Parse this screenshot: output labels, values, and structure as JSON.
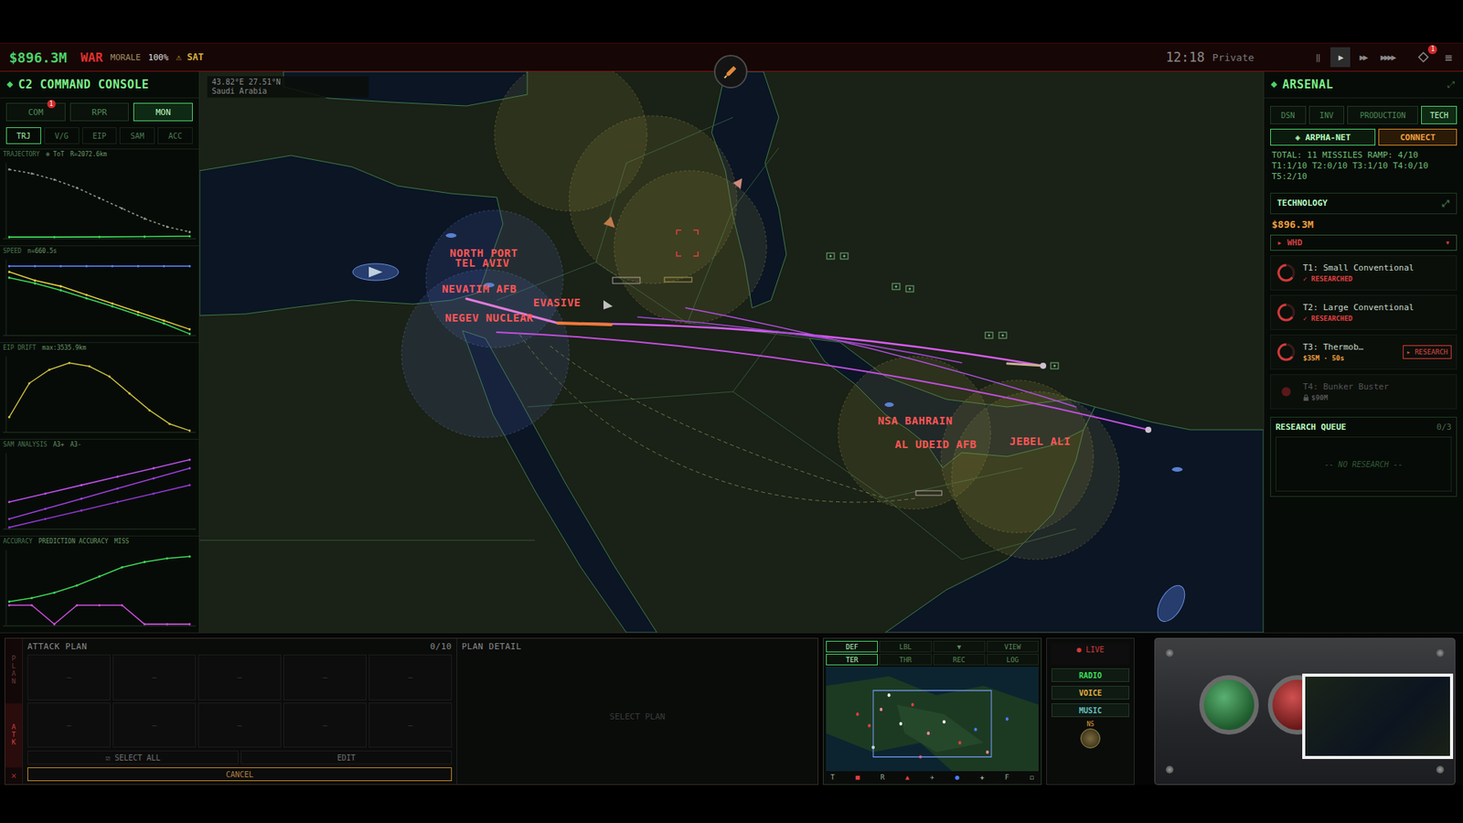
{
  "topbar": {
    "money": "$896.3M",
    "status": "WAR",
    "morale_label": "MORALE",
    "morale": "100%",
    "alert": "⚠ SAT",
    "clock": "12:18",
    "mode": "Private",
    "controls": [
      {
        "label": "‖",
        "selected": false
      },
      {
        "label": "▶",
        "selected": true
      },
      {
        "label": "▶▶",
        "selected": false
      },
      {
        "label": "▶▶▶▶",
        "selected": false
      }
    ],
    "notice_badge": "1",
    "menu": "≡"
  },
  "console": {
    "title": "C2 COMMAND CONSOLE",
    "tabs": [
      {
        "label": "COM",
        "selected": false,
        "badge": "1"
      },
      {
        "label": "RPR",
        "selected": false
      },
      {
        "label": "MON",
        "selected": true
      }
    ],
    "subtabs": [
      {
        "label": "TRJ",
        "selected": true
      },
      {
        "label": "V/G",
        "selected": false
      },
      {
        "label": "EIP",
        "selected": false
      },
      {
        "label": "SAM",
        "selected": false
      },
      {
        "label": "ACC",
        "selected": false
      }
    ],
    "charts": [
      {
        "title": "TRAJECTORY",
        "notes": [
          "⊗ ToT",
          "R=2072.6km"
        ],
        "series": [
          {
            "color": "#8a9a8a",
            "values": [
              400,
              380,
              350,
              310,
              260,
              210,
              160,
              120,
              95
            ]
          },
          {
            "color": "#3ddc5a",
            "values": [
              70,
              70,
              71,
              72,
              74
            ]
          }
        ]
      },
      {
        "title": "SPEED",
        "notes": [
          "n=660.5s"
        ],
        "series": [
          {
            "color": "#5a8aff",
            "values": [
              3.3,
              3.3,
              3.3,
              3.3,
              3.3,
              3.3,
              3.3,
              3.3
            ]
          },
          {
            "color": "#e0d040",
            "values": [
              3.2,
              3.05,
              2.95,
              2.8,
              2.65,
              2.5,
              2.35,
              2.2
            ]
          },
          {
            "color": "#3ddc5a",
            "values": [
              3.1,
              3.0,
              2.88,
              2.74,
              2.6,
              2.45,
              2.3,
              2.12
            ]
          }
        ]
      },
      {
        "title": "EIP DRIFT",
        "notes": [
          "max:3535.9km"
        ],
        "series": [
          {
            "color": "#c8c040",
            "values": [
              2.2,
              2.7,
              2.9,
              3.0,
              2.95,
              2.8,
              2.55,
              2.3,
              2.1,
              2.0
            ]
          }
        ]
      },
      {
        "title": "SAM ANALYSIS",
        "notes": [
          "A3+",
          "A3-"
        ],
        "series": [
          {
            "color": "#c050f0",
            "values": [
              2,
              3,
              4,
              5,
              6,
              7
            ]
          },
          {
            "color": "#a040e0",
            "values": [
              0,
              1.2,
              2.4,
              3.6,
              4.8,
              6
            ]
          },
          {
            "color": "#9038d0",
            "values": [
              -1,
              0,
              1,
              2,
              3,
              4
            ]
          }
        ]
      },
      {
        "title": "ACCURACY",
        "notes": [
          "PREDICTION ACCURACY",
          "MISS"
        ],
        "series": [
          {
            "color": "#3ddc5a",
            "values": [
              1,
              1.4,
              2,
              2.8,
              3.8,
              4.8,
              5.4,
              5.8,
              6
            ]
          },
          {
            "color": "#d050e0",
            "values": [
              0.6,
              0.6,
              -1.5,
              0.6,
              0.6,
              0.6,
              -1.5,
              -1.5,
              -1.5
            ]
          }
        ]
      }
    ]
  },
  "map": {
    "coords": "43.82°E 27.51°N",
    "region": "Saudi Arabia",
    "labels": [
      "NORTH PORT",
      "TEL AVIV",
      "NEVATIM AFB",
      "NEGEV NUCLEAR",
      "EVASIVE",
      "NSA BAHRAIN",
      "AL UDEID AFB",
      "JEBEL ALI"
    ]
  },
  "arsenal": {
    "title": "ARSENAL",
    "expand": "⤢",
    "tabs": [
      {
        "label": "DSN",
        "selected": false
      },
      {
        "label": "INV",
        "selected": false
      },
      {
        "label": "PRODUCTION",
        "selected": false
      },
      {
        "label": "TECH",
        "selected": true
      }
    ],
    "network": "◈ ARPHA-NET",
    "connect": "CONNECT",
    "stats": [
      "TOTAL: 11 MISSILES RAMP: 4/10",
      "T1:1/10 T2:0/10 T3:1/10 T4:0/10",
      "T5:2/10"
    ],
    "tech_title": "TECHNOLOGY",
    "funds": "$896.3M",
    "category": "▸ WHD",
    "category_arrow": "▾",
    "techs": [
      {
        "kind": "researched",
        "name": "T1: Small Conventional",
        "status": "✓ RESEARCHED"
      },
      {
        "kind": "researched",
        "name": "T2: Large Conventional",
        "status": "✓ RESEARCHED"
      },
      {
        "kind": "available",
        "name": "T3: Thermob…",
        "status": "$35M · 50s",
        "action": "▸ RESEARCH"
      },
      {
        "kind": "locked",
        "name": "T4: Bunker Buster",
        "status": "$90M"
      }
    ],
    "queue_title": "RESEARCH QUEUE",
    "queue_count": "0/3",
    "queue_empty": "-- NO RESEARCH --"
  },
  "attack_plan": {
    "title": "ATTACK PLAN",
    "count": "0/10",
    "strip": [
      {
        "label": "PLAN",
        "selected": false
      },
      {
        "label": "ATK",
        "selected": true
      }
    ],
    "close": "×",
    "slots": [
      "—",
      "—",
      "—",
      "—",
      "—",
      "—",
      "—",
      "—",
      "—",
      "—"
    ],
    "select_all": "☑ SELECT ALL",
    "edit": "EDIT",
    "cancel": "CANCEL",
    "detail_title": "PLAN DETAIL",
    "detail_empty": "SELECT PLAN"
  },
  "minimap": {
    "tabs": [
      {
        "label": "DEF",
        "selected": true
      },
      {
        "label": "LBL",
        "selected": false
      },
      {
        "label": "▼",
        "selected": false
      },
      {
        "label": "VIEW",
        "selected": false
      }
    ],
    "layers": [
      {
        "label": "TER",
        "selected": true
      },
      {
        "label": "THR",
        "selected": false
      },
      {
        "label": "REC",
        "selected": false
      },
      {
        "label": "LOG",
        "selected": false
      }
    ],
    "legend": [
      {
        "label": "T",
        "color": "#9ab09a"
      },
      {
        "label": "■",
        "color": "#e04040"
      },
      {
        "label": "R",
        "color": "#9ab09a"
      },
      {
        "label": "▲",
        "color": "#e04040"
      },
      {
        "label": "✈",
        "color": "#9ab09a"
      },
      {
        "label": "●",
        "color": "#4a80ff"
      },
      {
        "label": "✚",
        "color": "#9ab09a"
      },
      {
        "label": "F",
        "color": "#9ab09a"
      },
      {
        "label": "◻",
        "color": "#9ab09a"
      }
    ]
  },
  "radio": {
    "live": "● LIVE",
    "channels": [
      {
        "label": "RADIO",
        "color": "#3ddc5a"
      },
      {
        "label": "VOICE",
        "color": "#e0b040"
      },
      {
        "label": "MUSIC",
        "color": "#6ac0c0"
      }
    ],
    "knob": "NS"
  }
}
